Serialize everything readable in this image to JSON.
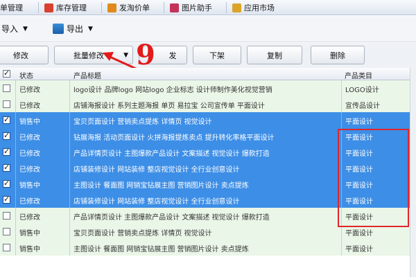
{
  "topbar": {
    "items": [
      {
        "label": "单管理",
        "icon": "none"
      },
      {
        "label": "库存管理",
        "icon": "warehouse-icon",
        "color": "#d9402f"
      },
      {
        "label": "发淘价单",
        "icon": "price-tag-icon",
        "color": "#e08a1c"
      },
      {
        "label": "图片助手",
        "icon": "image-icon",
        "color": "#c4315a"
      },
      {
        "label": "应用市场",
        "icon": "app-market-icon",
        "color": "#d9a428"
      }
    ]
  },
  "io": {
    "import_label": "导入",
    "export_label": "导出"
  },
  "actions": {
    "edit": "修改",
    "batch_edit": "批量修改",
    "publish": "发",
    "take_down": "下架",
    "copy": "复制",
    "delete": "删除"
  },
  "annotation": {
    "step": "9",
    "color": "#e21b1b"
  },
  "table": {
    "headers": {
      "status": "状态",
      "title": "产品标题",
      "category": "产品类目"
    },
    "rows": [
      {
        "checked": false,
        "selected": false,
        "status": "已修改",
        "title": "logo设计 品牌logo 网站logo 企业标志 设计师制作美化视觉营销",
        "category": "LOGO设计"
      },
      {
        "checked": false,
        "selected": false,
        "status": "已修改",
        "title": "店铺海报设计 系列主题海报 单页 易拉宝 公司宣传单 平面设计",
        "category": "宣传品设计"
      },
      {
        "checked": true,
        "selected": true,
        "status": "销售中",
        "title": "宝贝页面设计 营销卖点提炼 详情页 视觉设计",
        "category": "平面设计"
      },
      {
        "checked": true,
        "selected": true,
        "status": "已修改",
        "title": "钻展海报 活动页面设计 火拼海报提炼卖点 提升转化率格平面设计",
        "category": "平面设计"
      },
      {
        "checked": true,
        "selected": true,
        "status": "已修改",
        "title": "产品详情页设计 主图爆款产品设计 文案描述 视觉设计 爆款打造",
        "category": "平面设计"
      },
      {
        "checked": true,
        "selected": true,
        "status": "已修改",
        "title": "店铺装修设计 网站装修 整店视觉设计 全行业创意设计",
        "category": "平面设计"
      },
      {
        "checked": true,
        "selected": true,
        "status": "销售中",
        "title": "主图设计 餐面图 网销宝钻展主图 营销图片设计 卖点提炼",
        "category": "平面设计"
      },
      {
        "checked": true,
        "selected": true,
        "status": "已修改",
        "title": "店铺装修设计 网站装修 整店视觉设计 全行业创意设计",
        "category": "平面设计"
      },
      {
        "checked": false,
        "selected": false,
        "status": "已修改",
        "title": "产品详情页设计 主图爆款产品设计 文案描述 视觉设计 爆款打造",
        "category": "平面设计"
      },
      {
        "checked": false,
        "selected": false,
        "status": "销售中",
        "title": "宝贝页面设计 营销卖点提炼 详情页 视觉设计",
        "category": "平面设计"
      },
      {
        "checked": false,
        "selected": false,
        "status": "销售中",
        "title": "主图设计 餐面图 网销宝钻展主图 营销图片设计 卖点提炼",
        "category": "平面设计"
      }
    ]
  },
  "colors": {
    "selected_row": "#3d8ee6",
    "normal_row": "#eaf6e7",
    "highlight_box": "#e0262a"
  }
}
